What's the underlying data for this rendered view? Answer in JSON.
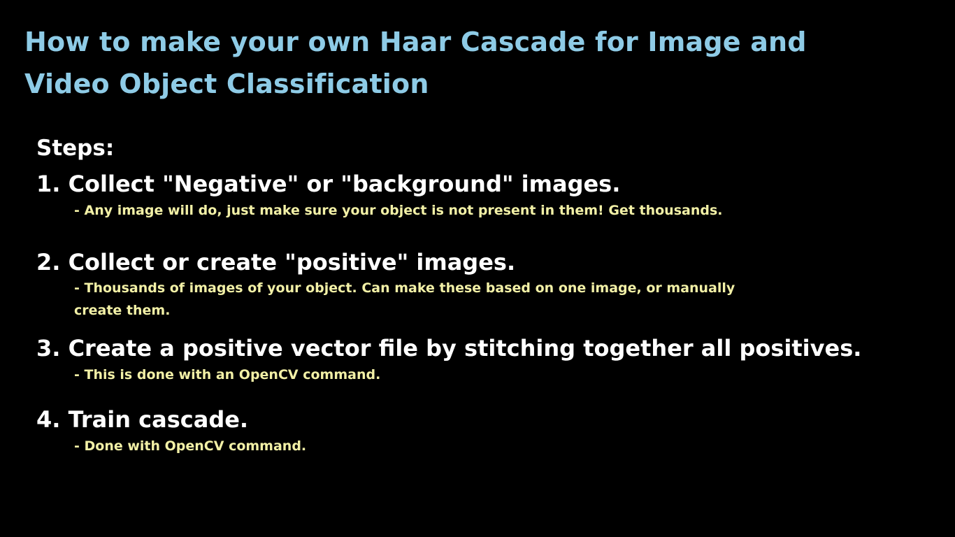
{
  "title": {
    "line1": "How to make your own Haar Cascade for Image and",
    "line2": "Video Object Classification"
  },
  "steps_heading": "Steps:",
  "steps": [
    {
      "label": "1. Collect \"Negative\" or \"background\" images.",
      "note_lines": [
        "- Any image will do, just make sure your object is not present in them! Get thousands."
      ]
    },
    {
      "label": "2. Collect or create \"positive\" images.",
      "note_lines": [
        "- Thousands of images of your object. Can make these based on one image, or manually",
        "create them."
      ]
    },
    {
      "label": "3. Create a positive vector file by stitching together all positives.",
      "note_lines": [
        "- This is done with an OpenCV command."
      ]
    },
    {
      "label": "4. Train cascade.",
      "note_lines": [
        "- Done with OpenCV command."
      ]
    }
  ],
  "colors": {
    "background": "#000000",
    "title": "#8ecbe6",
    "step_text": "#ffffff",
    "note_text": "#f2f0a6"
  }
}
